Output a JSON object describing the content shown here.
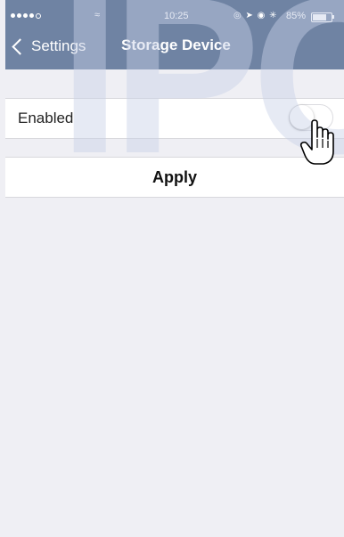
{
  "status_bar": {
    "time": "10:25",
    "battery_percent": "85%",
    "battery_level": 0.85
  },
  "nav": {
    "back_label": "Settings",
    "title": "Storage Device"
  },
  "settings": {
    "enabled_label": "Enabled",
    "enabled_on": false
  },
  "apply_label": "Apply",
  "watermark": "IPC",
  "colors": {
    "header": "#6f83a3",
    "background": "#efeff4"
  }
}
